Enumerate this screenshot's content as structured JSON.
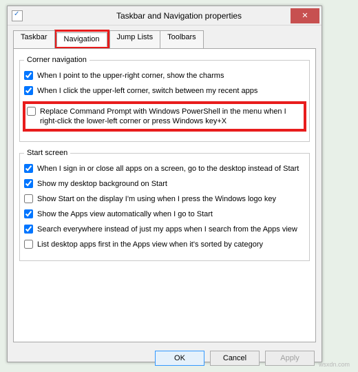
{
  "window": {
    "title": "Taskbar and Navigation properties"
  },
  "tabs": {
    "t0": "Taskbar",
    "t1": "Navigation",
    "t2": "Jump Lists",
    "t3": "Toolbars"
  },
  "groups": {
    "corner": {
      "legend": "Corner navigation",
      "c0": "When I point to the upper-right corner, show the charms",
      "c1": "When I click the upper-left corner, switch between my recent apps",
      "c2": "Replace Command Prompt with Windows PowerShell in the menu when I right-click the lower-left corner or press Windows key+X"
    },
    "start": {
      "legend": "Start screen",
      "s0": "When I sign in or close all apps on a screen, go to the desktop instead of Start",
      "s1": "Show my desktop background on Start",
      "s2": "Show Start on the display I'm using when I press the Windows logo key",
      "s3": "Show the Apps view automatically when I go to Start",
      "s4": "Search everywhere instead of just my apps when I search from the Apps view",
      "s5": "List desktop apps first in the Apps view when it's sorted by category"
    }
  },
  "buttons": {
    "ok": "OK",
    "cancel": "Cancel",
    "apply": "Apply"
  },
  "watermark": "wsxdn.com"
}
